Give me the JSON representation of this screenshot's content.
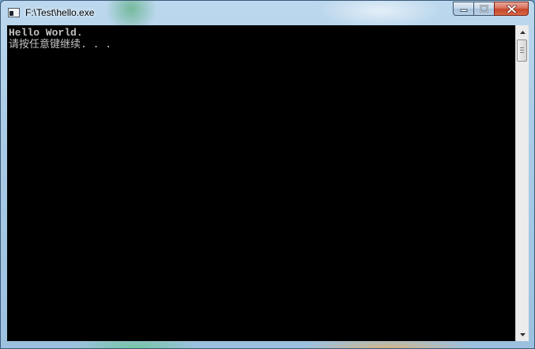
{
  "window": {
    "title": "F:\\Test\\hello.exe",
    "icon": "console-app-icon",
    "controls": {
      "minimize_icon": "minimize-icon",
      "maximize_icon": "maximize-icon",
      "close_icon": "close-icon"
    }
  },
  "console": {
    "background": "#000000",
    "text_color": "#c0c0c0",
    "lines": [
      "Hello World.",
      "请按任意键继续. . ."
    ]
  },
  "scrollbar": {
    "up_icon": "scroll-up-arrow-icon",
    "down_icon": "scroll-down-arrow-icon",
    "position": 0
  },
  "colors": {
    "close_button": "#c7452c",
    "frame": "#a9cbe6"
  }
}
